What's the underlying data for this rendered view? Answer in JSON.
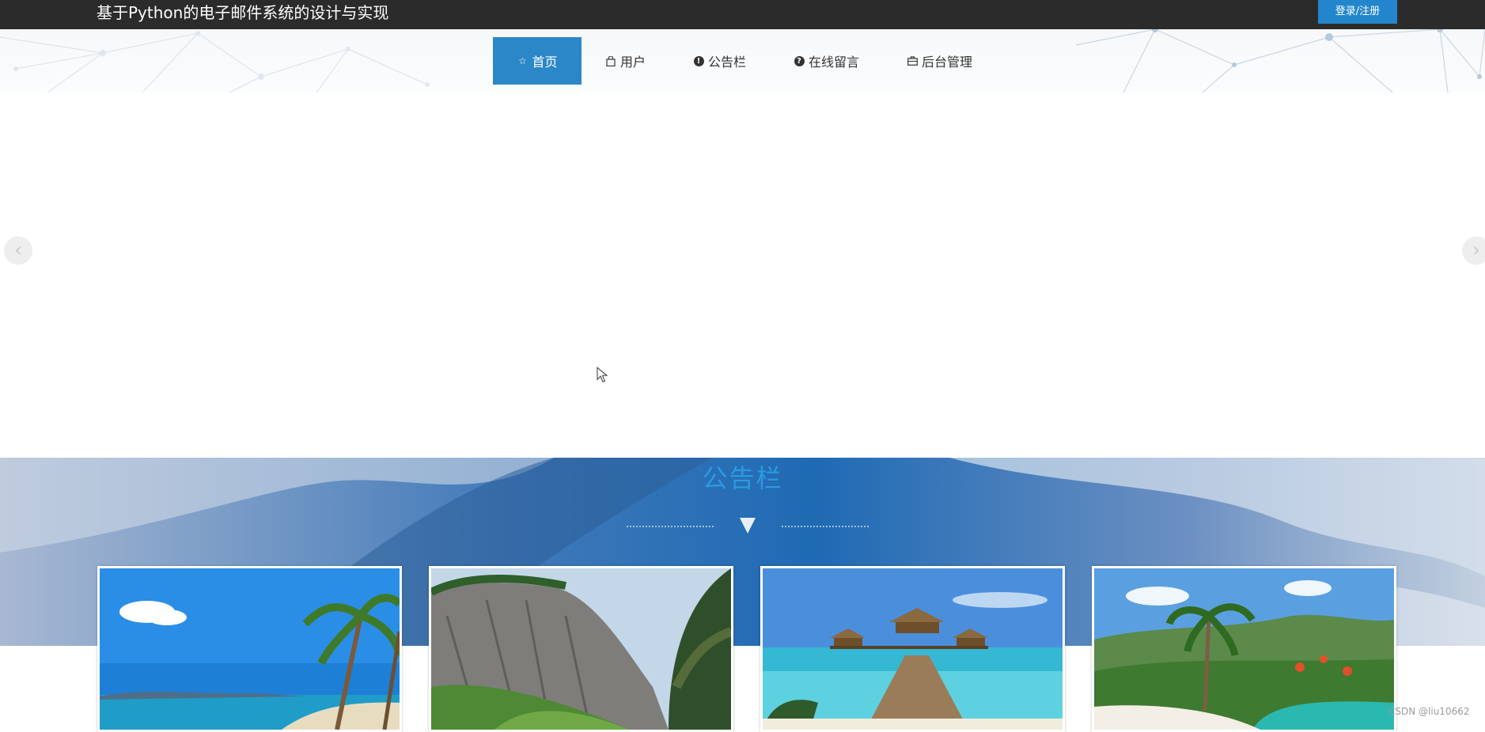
{
  "header": {
    "site_title": "基于Python的电子邮件系统的设计与实现",
    "login_label": "登录/注册"
  },
  "nav": {
    "items": [
      {
        "label": "首页",
        "icon": "star-icon",
        "active": true
      },
      {
        "label": "用户",
        "icon": "bag-icon"
      },
      {
        "label": "公告栏",
        "icon": "exclamation-circle-icon"
      },
      {
        "label": "在线留言",
        "icon": "question-circle-icon"
      },
      {
        "label": "后台管理",
        "icon": "briefcase-icon"
      }
    ]
  },
  "slider": {
    "prev_icon": "chevron-left-icon",
    "next_icon": "chevron-right-icon"
  },
  "notice": {
    "title": "公告栏",
    "cards": [
      {
        "image": "tropical-beach-palm-tree"
      },
      {
        "image": "rocky-cliff-mountain"
      },
      {
        "image": "overwater-bungalow-pier"
      },
      {
        "image": "resort-pool-palm-garden"
      }
    ]
  },
  "watermark": "CSDN @liu10662",
  "colors": {
    "topbar": "#2b2b2b",
    "accent": "#2b87c8",
    "notice_title": "#2a9ae0"
  }
}
